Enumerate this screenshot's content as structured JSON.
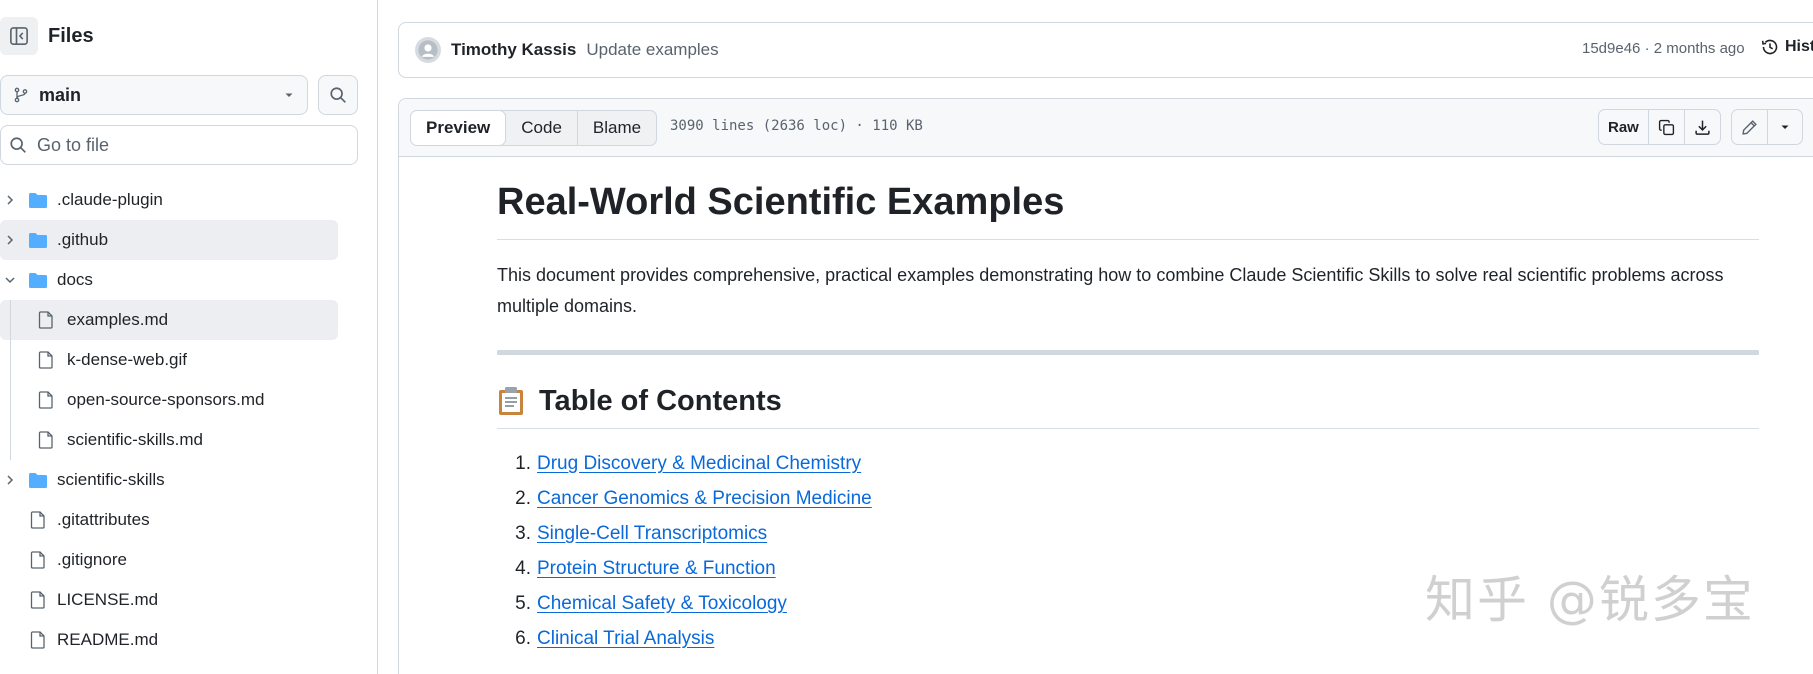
{
  "sidebar": {
    "title": "Files",
    "branch": "main",
    "goto_placeholder": "Go to file",
    "tree": [
      {
        "label": ".claude-plugin",
        "type": "folder",
        "expanded": false,
        "depth": 0
      },
      {
        "label": ".github",
        "type": "folder",
        "expanded": false,
        "depth": 0
      },
      {
        "label": "docs",
        "type": "folder",
        "expanded": true,
        "depth": 0
      },
      {
        "label": "examples.md",
        "type": "file",
        "depth": 1,
        "selected": true
      },
      {
        "label": "k-dense-web.gif",
        "type": "file",
        "depth": 1
      },
      {
        "label": "open-source-sponsors.md",
        "type": "file",
        "depth": 1
      },
      {
        "label": "scientific-skills.md",
        "type": "file",
        "depth": 1
      },
      {
        "label": "scientific-skills",
        "type": "folder",
        "expanded": false,
        "depth": 0
      },
      {
        "label": ".gitattributes",
        "type": "file",
        "depth": 0
      },
      {
        "label": ".gitignore",
        "type": "file",
        "depth": 0
      },
      {
        "label": "LICENSE.md",
        "type": "file",
        "depth": 0
      },
      {
        "label": "README.md",
        "type": "file",
        "depth": 0
      }
    ]
  },
  "commit": {
    "author": "Timothy Kassis",
    "message": "Update examples",
    "meta": "15d9e46 · 2 months ago",
    "history_label": "Hist"
  },
  "file_view": {
    "tabs": [
      "Preview",
      "Code",
      "Blame"
    ],
    "active_tab": "Preview",
    "info": "3090 lines (2636 loc) · 110 KB",
    "raw_label": "Raw"
  },
  "document": {
    "title": "Real-World Scientific Examples",
    "intro": "This document provides comprehensive, practical examples demonstrating how to combine Claude Scientific Skills to solve real scientific problems across multiple domains.",
    "toc_heading": "Table of Contents",
    "toc": [
      "Drug Discovery & Medicinal Chemistry",
      "Cancer Genomics & Precision Medicine",
      "Single-Cell Transcriptomics",
      "Protein Structure & Function",
      "Chemical Safety & Toxicology",
      "Clinical Trial Analysis"
    ]
  },
  "watermark": "知乎 @锐多宝",
  "colors": {
    "link": "#0969da",
    "folder": "#54aeff",
    "border": "#d0d7de",
    "selected_bg": "#eceef1"
  }
}
